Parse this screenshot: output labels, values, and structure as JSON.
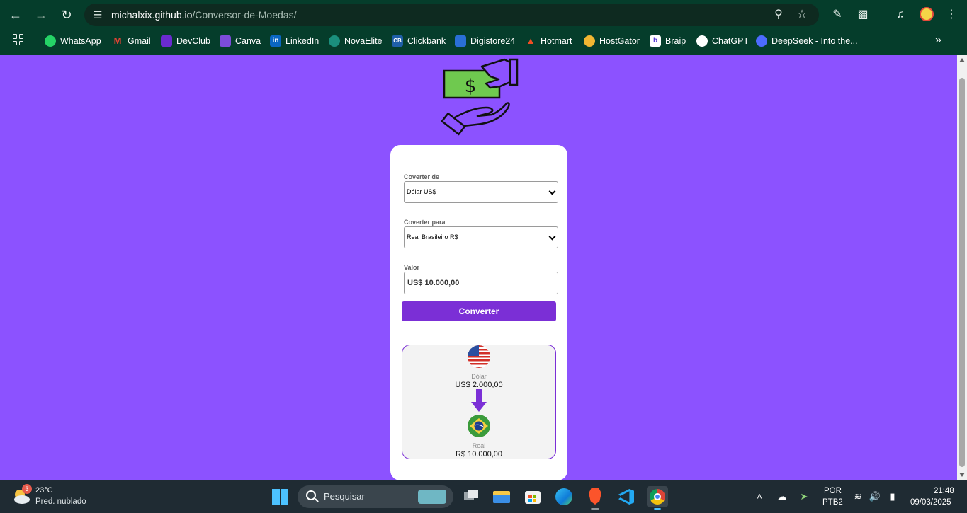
{
  "browser": {
    "url_host": "michalxix.github.io",
    "url_path": "/Conversor-de-Moedas/",
    "icons": [
      "back-icon",
      "forward-icon",
      "reload-icon",
      "site-info-icon",
      "zoom-icon",
      "bookmark-star-icon",
      "eyedropper-icon",
      "extensions-icon",
      "media-icon",
      "profile-avatar",
      "menu-icon"
    ]
  },
  "bookmarks": [
    {
      "label": "WhatsApp",
      "icon": "whatsapp-icon",
      "color": "#25d366"
    },
    {
      "label": "Gmail",
      "icon": "gmail-icon",
      "color": "#ea4335"
    },
    {
      "label": "DevClub",
      "icon": "devclub-icon",
      "color": "#6a2bd0"
    },
    {
      "label": "Canva",
      "icon": "canva-icon",
      "color": "#7d4cdb"
    },
    {
      "label": "LinkedIn",
      "icon": "linkedin-icon",
      "color": "#0a66c2"
    },
    {
      "label": "NovaElite",
      "icon": "novaelite-icon",
      "color": "#1b8f7d"
    },
    {
      "label": "Clickbank",
      "icon": "clickbank-icon",
      "color": "#1f5fa8"
    },
    {
      "label": "Digistore24",
      "icon": "digistore24-icon",
      "color": "#2a6fd6"
    },
    {
      "label": "Hotmart",
      "icon": "hotmart-icon",
      "color": "#f04e23"
    },
    {
      "label": "HostGator",
      "icon": "hostgator-icon",
      "color": "#f2b632"
    },
    {
      "label": "Braip",
      "icon": "braip-icon",
      "color": "#ffffff"
    },
    {
      "label": "ChatGPT",
      "icon": "chatgpt-icon",
      "color": "#ffffff"
    },
    {
      "label": "DeepSeek - Into the...",
      "icon": "deepseek-icon",
      "color": "#4d6bfe"
    }
  ],
  "app": {
    "from_label": "Coverter de",
    "from_value": "Dólar US$",
    "to_label": "Coverter para",
    "to_value": "Real Brasileiro R$",
    "amount_label": "Valor",
    "amount_value": "US$ 10.000,00",
    "convert_button": "Converter",
    "result": {
      "from_name": "Dólar",
      "from_value": "US$ 2.000,00",
      "to_name": "Real",
      "to_value": "R$ 10.000,00"
    },
    "accent_color": "#7b2fd6",
    "background_color": "#8c52ff"
  },
  "taskbar": {
    "weather_badge": "3",
    "temperature": "23°C",
    "weather_desc": "Pred. nublado",
    "search_placeholder": "Pesquisar",
    "lang_line1": "POR",
    "lang_line2": "PTB2",
    "time": "21:48",
    "date": "09/03/2025"
  }
}
